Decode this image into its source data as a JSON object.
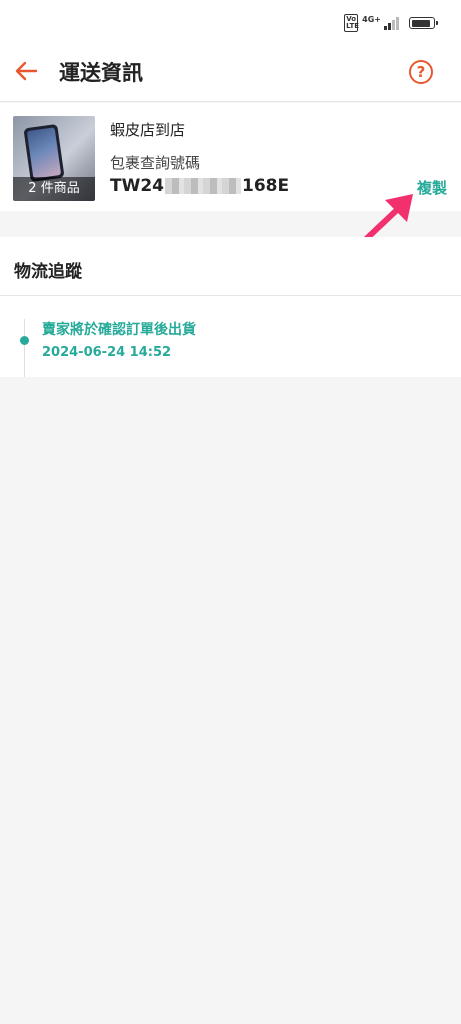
{
  "status_bar": {
    "volte": "Vo LTE",
    "network": "4G+"
  },
  "header": {
    "title": "運送資訊",
    "help_glyph": "?"
  },
  "order": {
    "thumbnail_caption": "2 件商品",
    "store": "蝦皮店到店",
    "tracking_label": "包裹查詢號碼",
    "tracking_prefix": "TW24",
    "tracking_suffix": "168E",
    "copy_label": "複製"
  },
  "tracking": {
    "section_title": "物流追蹤",
    "events": [
      {
        "description": "賣家將於確認訂單後出貨",
        "time": "2024-06-24 14:52"
      }
    ]
  },
  "colors": {
    "accent": "#e8572f",
    "teal": "#26aa99",
    "arrow": "#f2306e"
  },
  "icons": [
    "back-arrow-icon",
    "help-icon",
    "battery-icon",
    "signal-icon"
  ]
}
